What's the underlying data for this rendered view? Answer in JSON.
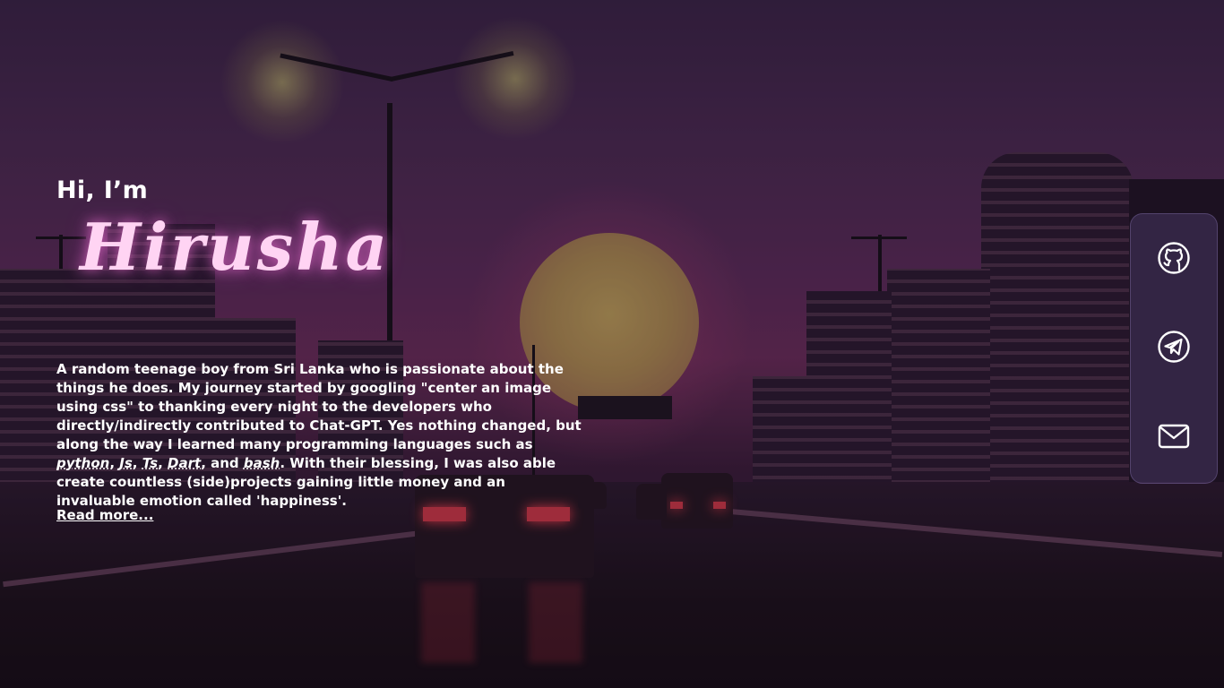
{
  "hero": {
    "greeting": "Hi, I’m",
    "name": "Hirusha"
  },
  "bio": {
    "part1": "A random teenage boy from Sri Lanka who is passionate about the things he does. My journey started by googling \"center an image using css\" to thanking every night to the developers who directly/indirectly contributed to Chat-GPT. Yes nothing changed, but along the way I learned many programming languages such as ",
    "lang1": "python",
    "sep1": ", ",
    "lang2": "Js",
    "sep2": ", ",
    "lang3": "Ts",
    "sep3": ", ",
    "lang4": "Dart",
    "sep4": ", and ",
    "lang5": "bash",
    "part2": ". With their blessing, I was also able create countless (side)projects gaining little money and an invaluable emotion called 'happiness'."
  },
  "read_more": "Read more...",
  "social": {
    "items": [
      {
        "icon": "github-icon"
      },
      {
        "icon": "telegram-icon"
      },
      {
        "icon": "mail-icon"
      }
    ]
  },
  "colors": {
    "name_glow": "#ffd4f3",
    "panel": "#6e5aa0",
    "sky": "#5c2c5a"
  }
}
